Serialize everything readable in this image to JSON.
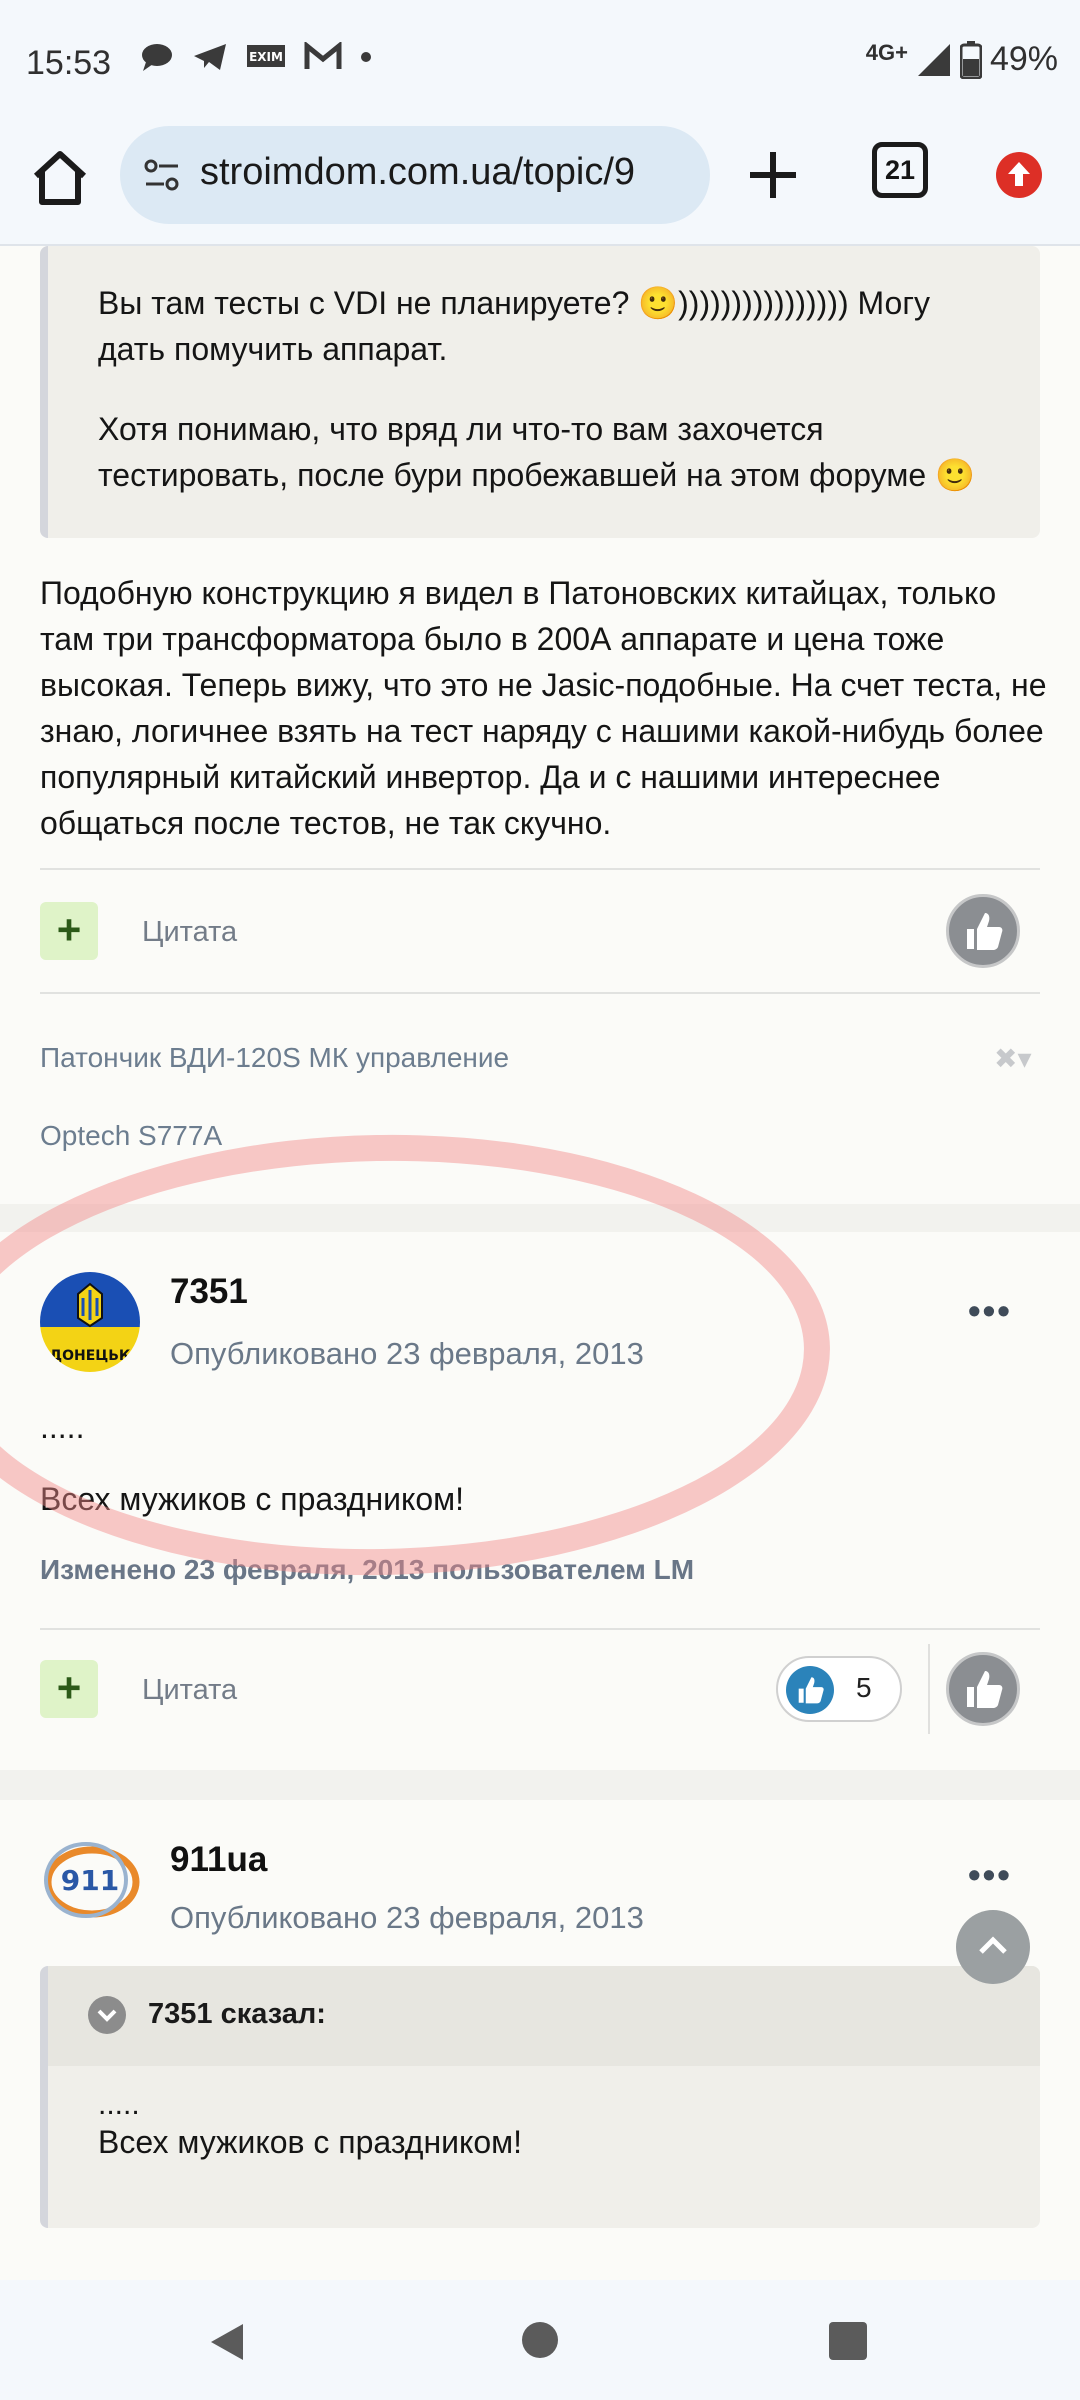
{
  "status_bar": {
    "time": "15:53",
    "network": "4G+",
    "battery": "49%"
  },
  "browser": {
    "url": "stroimdom.com.ua/topic/9",
    "tab_count": "21"
  },
  "post1": {
    "quote_p1": "Вы там тесты с VDI не планируете? 🙂)))))))))))))))) Могу дать помучить аппарат.",
    "quote_p2": "Хотя понимаю, что вряд ли что-то вам захочется тестировать, после бури пробежавшей на этом форуме 🙂",
    "body": "Подобную конструкцию я видел в Патоновских китайцах, только там три трансформатора было в 200А аппарате и цена тоже высокая. Теперь вижу, что это не Jasic-подобные. На счет теста, не знаю, логичнее взять на тест наряду с нашими какой-нибудь более популярный китайский инвертор. Да и с нашими интереснее общаться после тестов, не так скучно.",
    "plus_label": "+",
    "quote_label": "Цитата",
    "signature_line1": "Патончик ВДИ-120S МК управление",
    "signature_line2": "Optech S777A",
    "sig_close": "✖▾"
  },
  "post2": {
    "author": "7351",
    "avatar_text": "ДОНЕЦЬК",
    "posted": "Опубликовано 23 февраля, 2013",
    "more": "•••",
    "dots": ".....",
    "body": "Всех мужиков с праздником!",
    "edited": "Изменено 23 февраля, 2013 пользователем LM",
    "plus_label": "+",
    "quote_label": "Цитата",
    "reaction_count": "5"
  },
  "post3": {
    "author": "911ua",
    "avatar_text": "911",
    "posted": "Опубликовано 23 февраля, 2013",
    "more": "•••",
    "quote_author": "7351 сказал:",
    "quote_dots": ".....",
    "quote_text": "Всех мужиков с праздником!"
  },
  "colors": {
    "accent_like": "#2b83ba",
    "highlight": "#f28888"
  }
}
